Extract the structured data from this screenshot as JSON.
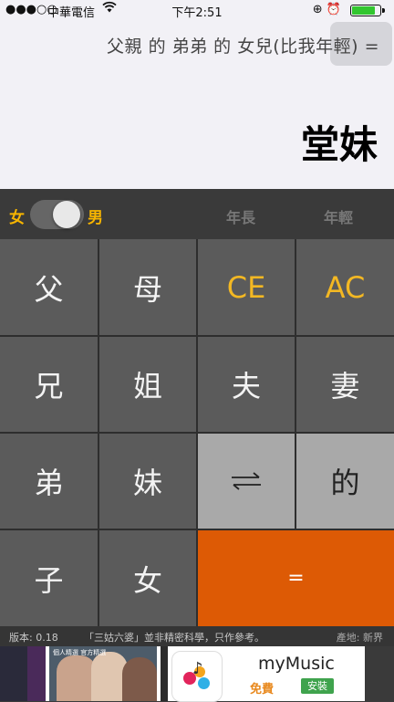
{
  "status_bar": {
    "signal": "●●●○○",
    "carrier": "中華電信",
    "wifi": "wifi-icon",
    "time": "下午2:51",
    "status_icons": "⊕ ⏰",
    "battery_level": 0.85,
    "battery_color": "#32c62f"
  },
  "display": {
    "expression": "父親 的 弟弟 的 女兒(比我年輕) =",
    "result": "堂妹"
  },
  "controls": {
    "female_label": "女",
    "male_label": "男",
    "gender_toggle_on": true,
    "older_label": "年長",
    "younger_label": "年輕"
  },
  "keypad": {
    "father": "父",
    "mother": "母",
    "clear_entry": "CE",
    "all_clear": "AC",
    "elder_brother": "兄",
    "elder_sister": "姐",
    "husband": "夫",
    "wife": "妻",
    "younger_brother": "弟",
    "younger_sister": "妹",
    "swap": "⇄",
    "of": "的",
    "son": "子",
    "daughter": "女",
    "equals": "="
  },
  "footer": {
    "version": "版本: 0.18",
    "disclaimer": "「三姑六婆」並非精密科學，只作參考。",
    "origin": "產地: 新界"
  },
  "ad": {
    "title": "myMusic",
    "free": "免費",
    "install": "安裝",
    "promo_caption": "個人精選   官方精選"
  },
  "colors": {
    "accent": "#f7b500",
    "equals": "#dd5a05",
    "key": "#5b5b5b"
  }
}
